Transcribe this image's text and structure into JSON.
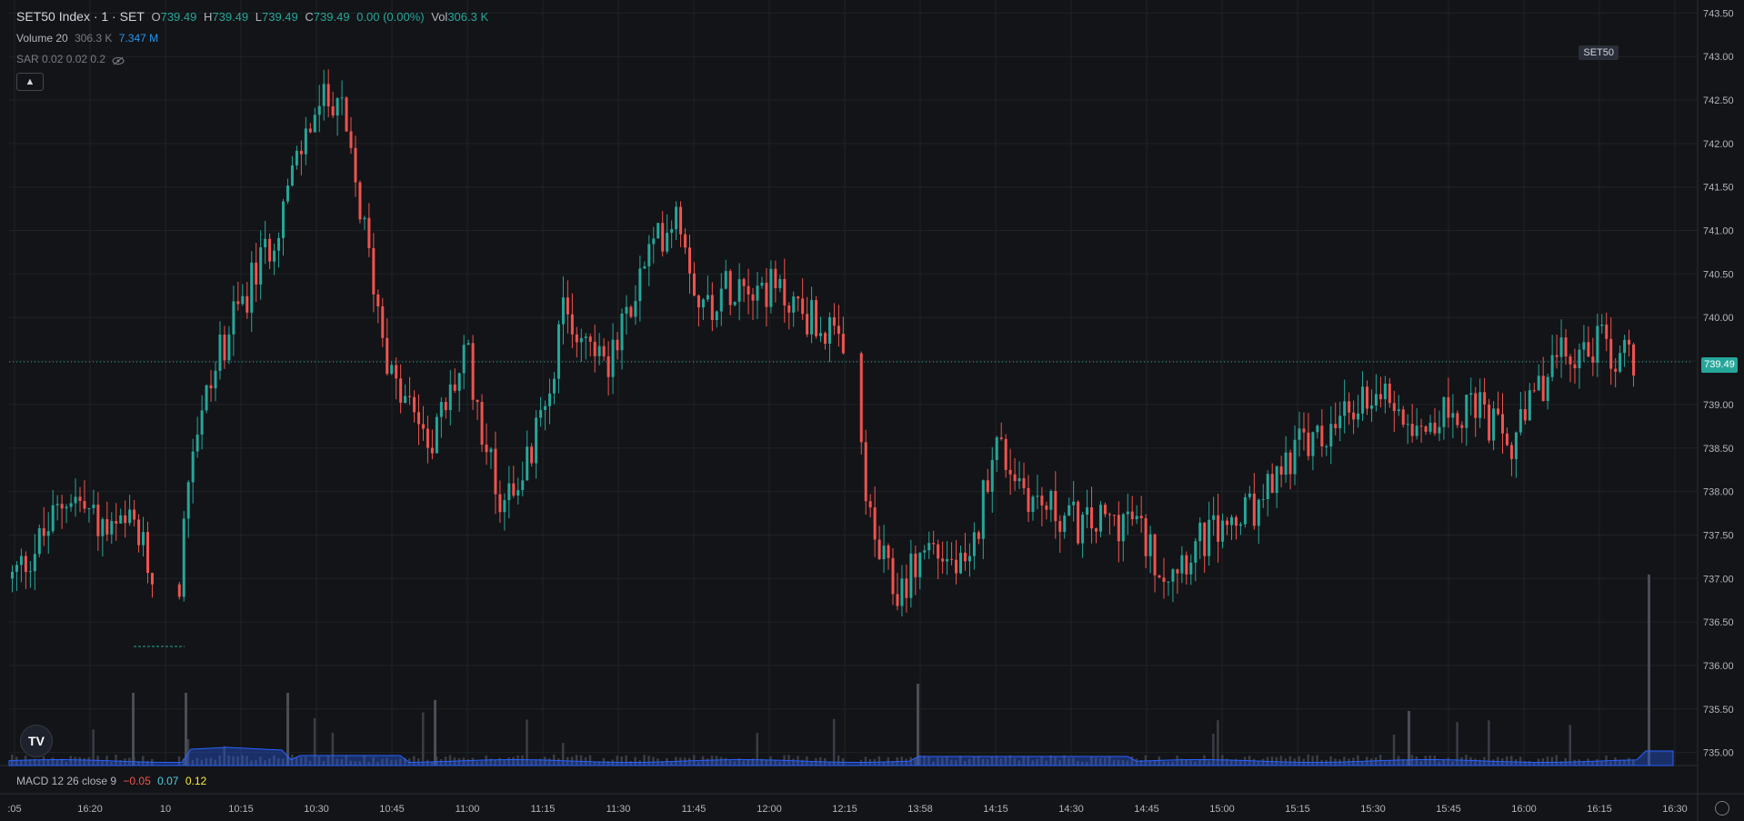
{
  "legend": {
    "symbol": "SET50 Index · 1 · SET",
    "o_label": "O",
    "o_val": "739.49",
    "h_label": "H",
    "h_val": "739.49",
    "l_label": "L",
    "l_val": "739.49",
    "c_label": "C",
    "c_val": "739.49",
    "change": "0.00 (0.00%)",
    "vol_label": "Vol",
    "vol_val": "306.3 K",
    "volume_name": "Volume 20",
    "volume_v1": "306.3 K",
    "volume_v2": "7.347 M",
    "sar": "SAR 0.02 0.02 0.2",
    "macd_name": "MACD 12 26 close 9",
    "macd_v1": "−0.05",
    "macd_v2": "0.07",
    "macd_v3": "0.12"
  },
  "symbol_tag": "SET50",
  "last_price_tag": "739.49",
  "logo_text": "TV",
  "colors": {
    "up": "#26a69a",
    "down": "#ef5350",
    "volume_ma": "#2962ff",
    "background": "#131417",
    "grid": "#1f2227"
  },
  "chart_data": {
    "type": "candlestick",
    "y_axis": {
      "ticks": [
        "735.00",
        "735.50",
        "736.00",
        "736.50",
        "737.00",
        "737.50",
        "738.00",
        "738.50",
        "739.00",
        "739.50",
        "740.00",
        "740.50",
        "741.00",
        "741.50",
        "742.00",
        "742.50",
        "743.00",
        "743.50"
      ],
      "min": 734.85,
      "max": 743.65,
      "last_price": 739.49
    },
    "x_axis": {
      "ticks": [
        ":05",
        "16:20",
        "10",
        "10:15",
        "10:30",
        "10:45",
        "11:00",
        "11:15",
        "11:30",
        "11:45",
        "12:00",
        "12:15",
        "13:58",
        "14:15",
        "14:30",
        "14:45",
        "15:00",
        "15:15",
        "15:30",
        "15:45",
        "16:00",
        "16:15",
        "16:30"
      ]
    },
    "price_anchors": [
      {
        "t": 0,
        "p": 737.0
      },
      {
        "t": 0.02,
        "p": 737.5
      },
      {
        "t": 0.035,
        "p": 738.0
      },
      {
        "t": 0.06,
        "p": 737.5
      },
      {
        "t": 0.075,
        "p": 737.6
      },
      {
        "t": 0.1,
        "p": 736.3
      },
      {
        "t": 0.11,
        "p": 738.5
      },
      {
        "t": 0.13,
        "p": 739.7
      },
      {
        "t": 0.16,
        "p": 740.9
      },
      {
        "t": 0.185,
        "p": 742.3
      },
      {
        "t": 0.2,
        "p": 742.6
      },
      {
        "t": 0.215,
        "p": 741.2
      },
      {
        "t": 0.235,
        "p": 739.2
      },
      {
        "t": 0.26,
        "p": 738.6
      },
      {
        "t": 0.28,
        "p": 739.6
      },
      {
        "t": 0.3,
        "p": 737.9
      },
      {
        "t": 0.32,
        "p": 738.4
      },
      {
        "t": 0.34,
        "p": 740.0
      },
      {
        "t": 0.37,
        "p": 739.5
      },
      {
        "t": 0.39,
        "p": 740.6
      },
      {
        "t": 0.41,
        "p": 741.3
      },
      {
        "t": 0.425,
        "p": 740.1
      },
      {
        "t": 0.45,
        "p": 740.5
      },
      {
        "t": 0.48,
        "p": 740.2
      },
      {
        "t": 0.505,
        "p": 739.8
      },
      {
        "t": 0.52,
        "p": 739.1
      },
      {
        "t": 0.53,
        "p": 737.5
      },
      {
        "t": 0.545,
        "p": 736.8
      },
      {
        "t": 0.565,
        "p": 737.4
      },
      {
        "t": 0.59,
        "p": 737.0
      },
      {
        "t": 0.605,
        "p": 738.6
      },
      {
        "t": 0.63,
        "p": 737.9
      },
      {
        "t": 0.66,
        "p": 737.6
      },
      {
        "t": 0.69,
        "p": 737.7
      },
      {
        "t": 0.71,
        "p": 737.1
      },
      {
        "t": 0.74,
        "p": 737.5
      },
      {
        "t": 0.77,
        "p": 737.8
      },
      {
        "t": 0.79,
        "p": 738.5
      },
      {
        "t": 0.81,
        "p": 738.6
      },
      {
        "t": 0.84,
        "p": 739.2
      },
      {
        "t": 0.87,
        "p": 738.8
      },
      {
        "t": 0.9,
        "p": 739.0
      },
      {
        "t": 0.925,
        "p": 738.5
      },
      {
        "t": 0.95,
        "p": 739.5
      },
      {
        "t": 0.98,
        "p": 739.7
      },
      {
        "t": 1.0,
        "p": 739.49
      }
    ]
  }
}
